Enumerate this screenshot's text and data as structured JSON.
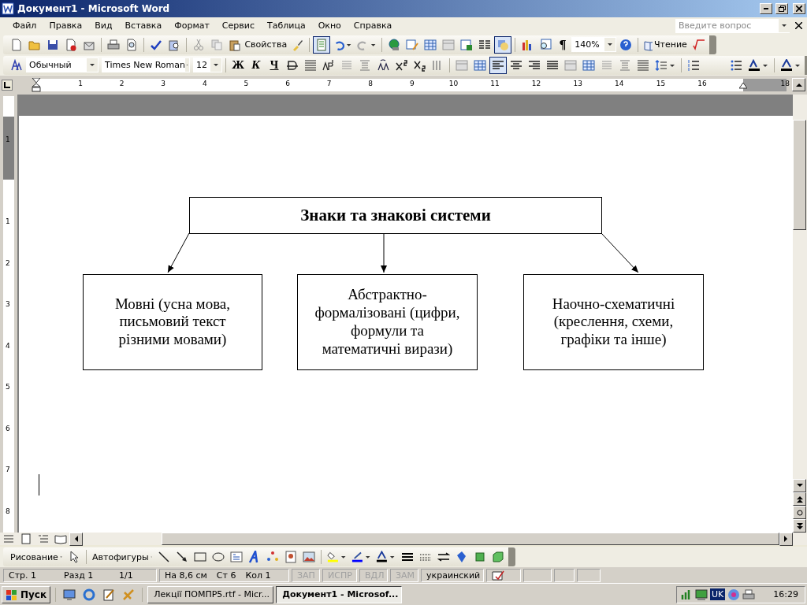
{
  "window": {
    "title": "Документ1 - Microsoft Word"
  },
  "menu": [
    "Файл",
    "Правка",
    "Вид",
    "Вставка",
    "Формат",
    "Сервис",
    "Таблица",
    "Окно",
    "Справка"
  ],
  "help_search": {
    "placeholder": "Введите вопрос"
  },
  "standard_toolbar": {
    "properties_label": "Свойства",
    "view_toggle_on": true,
    "drawing_toggle_on": true,
    "show_formatting": "¶",
    "zoom": "140%",
    "reading_label": "Чтение"
  },
  "formatting_toolbar": {
    "style": "Обычный",
    "font": "Times New Roman",
    "size": "12",
    "bold": "Ж",
    "italic": "К",
    "underline": "Ч",
    "alignments": [
      {
        "kind": "left",
        "selected": true
      },
      {
        "kind": "center",
        "selected": false
      },
      {
        "kind": "right",
        "selected": false
      },
      {
        "kind": "justify",
        "selected": false
      }
    ]
  },
  "ruler": {
    "marks": [
      "1",
      "2",
      "3",
      "4",
      "5",
      "6",
      "7",
      "8",
      "9",
      "10",
      "11",
      "12",
      "13",
      "14",
      "15",
      "16",
      "18"
    ]
  },
  "vertical_ruler": {
    "marks": [
      "1",
      "1",
      "2",
      "3",
      "4",
      "5",
      "6",
      "7",
      "8"
    ]
  },
  "diagram": {
    "root": "Знаки та знакові системи",
    "children": [
      "Мовні (усна мова, письмовий текст різними мовами)",
      "Абстрактно-формалізовані (цифри, формули та математичні вирази)",
      "Наочно-схематичні (креслення, схеми, графіки та інше)"
    ]
  },
  "drawing_toolbar": {
    "drawing_menu": "Рисование",
    "autoshapes_menu": "Автофигуры"
  },
  "status_bar": {
    "fields": [
      "Стр. 1",
      "Разд 1",
      "1/1"
    ],
    "position": [
      "На 8,6 см",
      "Ст 6",
      "Кол 1"
    ],
    "modes": [
      {
        "label": "ЗАП",
        "disabled": true
      },
      {
        "label": "ИСПР",
        "disabled": true
      },
      {
        "label": "ВДЛ",
        "disabled": true
      },
      {
        "label": "ЗАМ",
        "disabled": true
      }
    ],
    "language": "украинский"
  },
  "taskbar": {
    "start": "Пуск",
    "tasks": [
      {
        "label": "Лекції ПОМПР5.rtf - Micr...",
        "selected": false
      },
      {
        "label": "Документ1 - Microsof...",
        "selected": true
      }
    ],
    "language": "UK",
    "time": "16:29"
  }
}
